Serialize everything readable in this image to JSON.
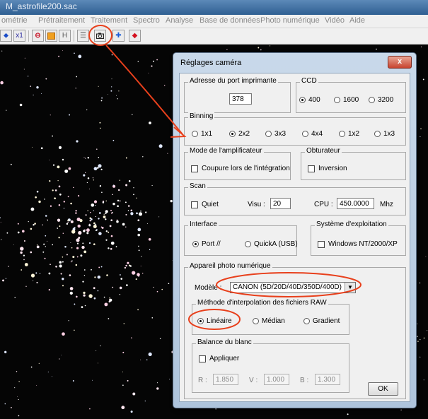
{
  "window": {
    "title": "M_astrofile200.sac"
  },
  "menu": [
    "ométrie",
    "Prétraitement",
    "Traitement",
    "Spectro",
    "Analyse",
    "Base de données",
    "Photo numérique",
    "Vidéo",
    "Aide"
  ],
  "toolbar": {
    "x1_label": "x1",
    "h_label": "H"
  },
  "dialog": {
    "title": "Réglages caméra",
    "close_label": "x",
    "port": {
      "label": "Adresse du port imprimante",
      "value": "378"
    },
    "ccd": {
      "label": "CCD",
      "options": [
        "400",
        "1600",
        "3200"
      ],
      "selected": "400"
    },
    "binning": {
      "label": "Binning",
      "options": [
        "1x1",
        "2x2",
        "3x3",
        "4x4",
        "1x2",
        "1x3"
      ],
      "selected": "2x2"
    },
    "amplifier": {
      "label": "Mode de l'amplificateur",
      "checkbox": "Coupure lors de l'intégration"
    },
    "shutter": {
      "label": "Obturateur",
      "checkbox": "Inversion"
    },
    "scan": {
      "label": "Scan",
      "quiet": "Quiet",
      "visu_label": "Visu :",
      "visu_value": "20",
      "cpu_label": "CPU :",
      "cpu_value": "450.0000",
      "cpu_unit": "Mhz"
    },
    "interface": {
      "label": "Interface",
      "options": [
        "Port //",
        "QuickA (USB)"
      ],
      "selected": "Port //"
    },
    "os": {
      "label": "Système d'exploitation",
      "checkbox": "Windows NT/2000/XP"
    },
    "camera": {
      "label": "Appareil photo numérique",
      "model_label": "Modèle :",
      "model_value": "CANON (5D/20D/40D/350D/400D)"
    },
    "interp": {
      "label": "Méthode d'interpolation des fichiers RAW",
      "options": [
        "Linéaire",
        "Médian",
        "Gradient"
      ],
      "selected": "Linéaire"
    },
    "white": {
      "label": "Balance du blanc",
      "checkbox": "Appliquer",
      "r_label": "R :",
      "r_value": "1.850",
      "v_label": "V :",
      "v_value": "1.000",
      "b_label": "B :",
      "b_value": "1.300"
    },
    "ok_label": "OK"
  },
  "colors": {
    "annotation": "#e8401c",
    "sky": "#050505",
    "dialog_frame": "#aec4dc"
  },
  "icons": [
    "star-icon",
    "toggle-icon",
    "camera-icon",
    "cross-icon",
    "record-icon",
    "dropdown-arrow-icon"
  ]
}
